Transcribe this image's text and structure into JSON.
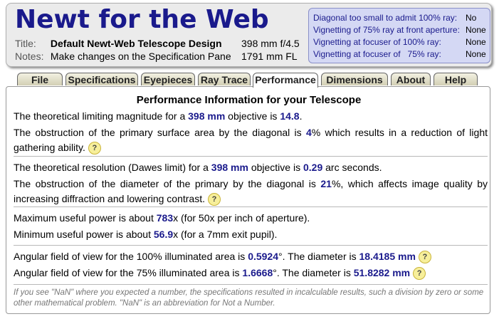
{
  "app_title": "Newt for the Web",
  "meta": {
    "title_label": "Title:",
    "title_value": "Default Newt-Web Telescope Design",
    "notes_label": "Notes:",
    "notes_value": "Make changes on the Specification Pane",
    "aperture": "398 mm f/4.5",
    "focal_length": "1791 mm FL"
  },
  "vignetting": [
    {
      "label": "Diagonal too small to admit 100% ray:",
      "value": "No"
    },
    {
      "label": "Vignetting of 75% ray at front aperture:",
      "value": "None"
    },
    {
      "label": "Vignetting at focuser of 100% ray:",
      "value": "None"
    },
    {
      "label": "Vignetting at focuser of   75% ray:",
      "value": "None"
    }
  ],
  "tabs": [
    "File",
    "Specifications",
    "Eyepieces",
    "Ray Trace",
    "Performance",
    "Dimensions",
    "About",
    "Help"
  ],
  "active_tab": "Performance",
  "panel": {
    "title": "Performance Information for your Telescope",
    "lim_mag": {
      "a": "The theoretical limiting magnitude for a ",
      "aperture": "398 mm",
      "b": " objective is ",
      "value": "14.8",
      "c": "."
    },
    "obstruction_area": {
      "a": "The obstruction of the primary surface area by the diagonal is ",
      "value": "4",
      "b": "% which results in a reduction of light gathering ability."
    },
    "resolution": {
      "a": "The theoretical resolution (Dawes limit) for a ",
      "aperture": "398 mm",
      "b": " objective is ",
      "value": "0.29",
      "c": " arc seconds."
    },
    "obstruction_diam": {
      "a": "The obstruction of the diameter of the primary by the diagonal is ",
      "value": "21",
      "b": "%, which affects image quality by increasing diffraction and lowering contrast."
    },
    "max_power": {
      "a": "Maximum useful power is about ",
      "value": "783",
      "b": "x (for 50x per inch of aperture)."
    },
    "min_power": {
      "a": "Minimum useful power is about ",
      "value": "56.9",
      "b": "x (for a 7mm exit pupil)."
    },
    "fov100": {
      "a": "Angular field of view for the 100% illuminated area is ",
      "angle": "0.5924",
      "b": "°. The diameter is ",
      "diam": "18.4185 mm"
    },
    "fov75": {
      "a": "Angular field of view for the 75% illuminated area is ",
      "angle": "1.6668",
      "b": "°. The diameter is ",
      "diam": "51.8282 mm"
    },
    "help_glyph": "?",
    "note": "If you see \"NaN\" where you expected a number, the specifications resulted in incalculable results, such a division by zero or some other mathematical problem. \"NaN\" is an abbreviation for Not a Number."
  }
}
